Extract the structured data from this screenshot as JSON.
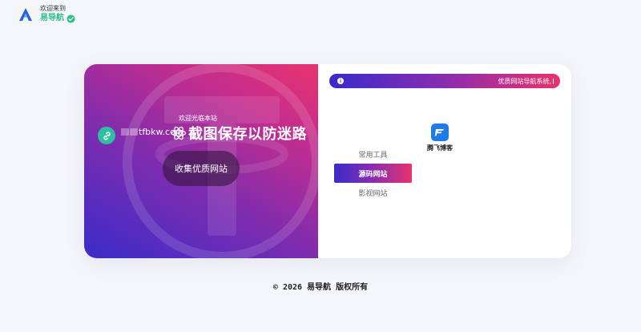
{
  "brand": {
    "greeting": "欢迎来到",
    "name": "易导航"
  },
  "hero": {
    "welcome": "欢迎光临本站",
    "domain": "tfbkw.com",
    "slogan": "截图保存以防迷路",
    "collect_button": "收集优质网站"
  },
  "notice": {
    "text": "优质网站导航系统,"
  },
  "tabs": [
    {
      "label": "常用工具",
      "active": false
    },
    {
      "label": "源码网站",
      "active": true
    },
    {
      "label": "影视网站",
      "active": false
    }
  ],
  "sites": [
    {
      "name": "腾飞博客",
      "icon": "tengfei-logo-icon"
    }
  ],
  "footer": {
    "text": "© 2026 易导航 版权所有"
  },
  "colors": {
    "accent_green": "#2ec08a",
    "gradient_start": "#3a2bc9",
    "gradient_mid": "#8a2cb0",
    "gradient_end": "#e8336e",
    "site_logo_blue": "#1e7be8"
  }
}
